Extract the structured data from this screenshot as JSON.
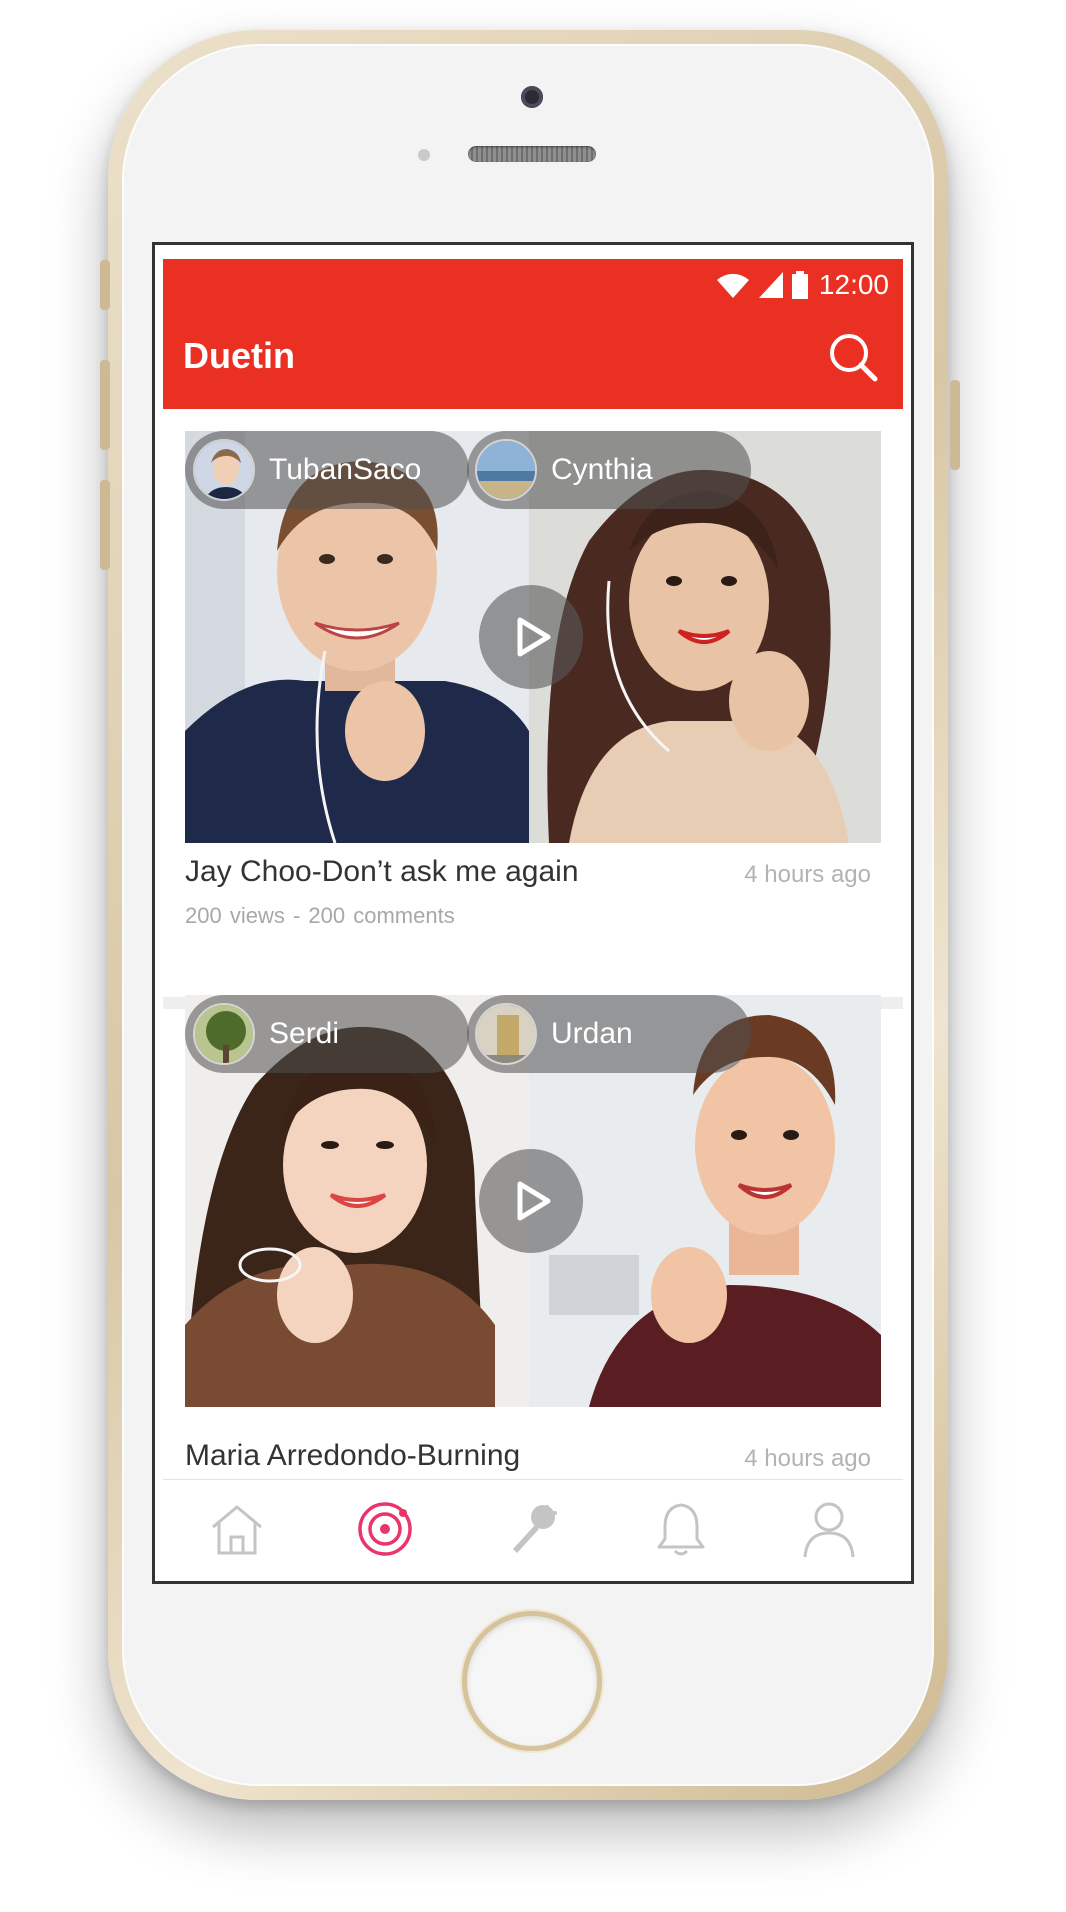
{
  "status_bar": {
    "time": "12:00"
  },
  "app_bar": {
    "title": "Duetin"
  },
  "colors": {
    "brand": "#ea3023",
    "accent": "#e8366a",
    "muted": "#b3b3b3"
  },
  "feed": [
    {
      "left_user": "TubanSaco",
      "right_user": "Cynthia",
      "title": "Jay Choo-Don’t ask me again",
      "time_ago": "4 hours ago",
      "views": "200 views",
      "separator": "-",
      "comments": "200 comments"
    },
    {
      "left_user": "Serdi",
      "right_user": "Urdan",
      "title": "Maria Arredondo-Burning",
      "time_ago": "4 hours ago"
    }
  ],
  "bottom_nav": [
    {
      "icon": "home-icon",
      "active": false
    },
    {
      "icon": "discover-icon",
      "active": true
    },
    {
      "icon": "microphone-icon",
      "active": false
    },
    {
      "icon": "bell-icon",
      "active": false
    },
    {
      "icon": "profile-icon",
      "active": false
    }
  ]
}
